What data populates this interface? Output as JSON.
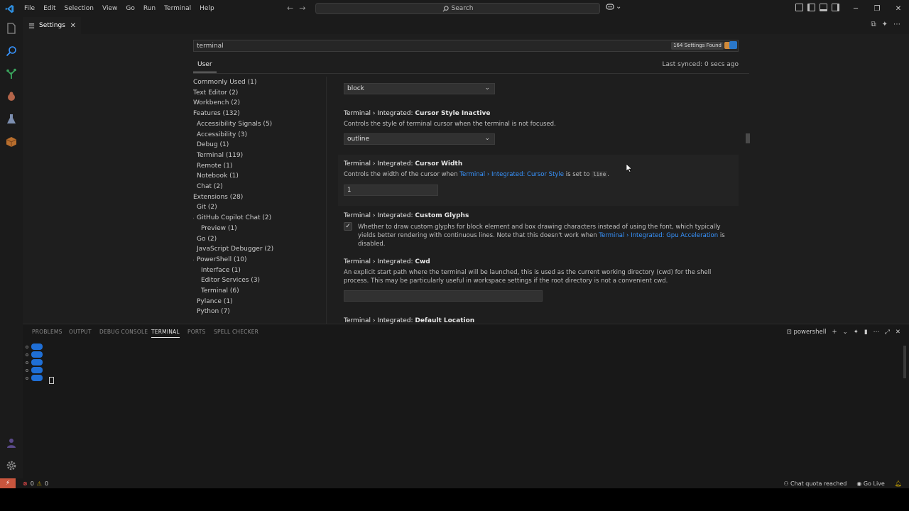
{
  "menu": [
    "File",
    "Edit",
    "Selection",
    "View",
    "Go",
    "Run",
    "Terminal",
    "Help"
  ],
  "search": {
    "placeholder": "Search"
  },
  "tab": {
    "title": "Settings"
  },
  "settings": {
    "query": "terminal",
    "found": "164 Settings Found",
    "scope": "User",
    "synced": "Last synced: 0 secs ago",
    "toc": [
      {
        "label": "Commonly Used (1)",
        "level": 0,
        "chev": ""
      },
      {
        "label": "Text Editor (2)",
        "level": 0,
        "chev": ""
      },
      {
        "label": "Workbench (2)",
        "level": 0,
        "chev": ""
      },
      {
        "label": "Features (132)",
        "level": 0,
        "chev": "v"
      },
      {
        "label": "Accessibility Signals (5)",
        "level": 1,
        "chev": ""
      },
      {
        "label": "Accessibility (3)",
        "level": 1,
        "chev": ""
      },
      {
        "label": "Debug (1)",
        "level": 1,
        "chev": ""
      },
      {
        "label": "Terminal (119)",
        "level": 1,
        "chev": ""
      },
      {
        "label": "Remote (1)",
        "level": 1,
        "chev": ""
      },
      {
        "label": "Notebook (1)",
        "level": 1,
        "chev": ""
      },
      {
        "label": "Chat (2)",
        "level": 1,
        "chev": ""
      },
      {
        "label": "Extensions (28)",
        "level": 0,
        "chev": "v"
      },
      {
        "label": "Git (2)",
        "level": 1,
        "chev": ""
      },
      {
        "label": "GitHub Copilot Chat (2)",
        "level": 1,
        "chev": "v"
      },
      {
        "label": "Preview (1)",
        "level": 2,
        "chev": ""
      },
      {
        "label": "Go (2)",
        "level": 1,
        "chev": ""
      },
      {
        "label": "JavaScript Debugger (2)",
        "level": 1,
        "chev": ""
      },
      {
        "label": "PowerShell (10)",
        "level": 1,
        "chev": "v"
      },
      {
        "label": "Interface (1)",
        "level": 2,
        "chev": ""
      },
      {
        "label": "Editor Services (3)",
        "level": 2,
        "chev": ""
      },
      {
        "label": "Terminal (6)",
        "level": 2,
        "chev": ""
      },
      {
        "label": "Pylance (1)",
        "level": 1,
        "chev": ""
      },
      {
        "label": "Python (7)",
        "level": 1,
        "chev": ""
      }
    ],
    "items": {
      "cursor_style": {
        "value": "block"
      },
      "cursor_style_inactive": {
        "prefix": "Terminal › Integrated: ",
        "name": "Cursor Style Inactive",
        "desc": "Controls the style of terminal cursor when the terminal is not focused.",
        "value": "outline"
      },
      "cursor_width": {
        "prefix": "Terminal › Integrated: ",
        "name": "Cursor Width",
        "desc_pre": "Controls the width of the cursor when ",
        "desc_link": "Terminal › Integrated: Cursor Style",
        "desc_mid": " is set to ",
        "desc_code": "line",
        "desc_post": ".",
        "value": "1"
      },
      "custom_glyphs": {
        "prefix": "Terminal › Integrated: ",
        "name": "Custom Glyphs",
        "desc_pre": "Whether to draw custom glyphs for block element and box drawing characters instead of using the font, which typically yields better rendering with continuous lines. Note that this doesn't work when ",
        "desc_link": "Terminal › Integrated: Gpu Acceleration",
        "desc_post": " is disabled.",
        "checked": "✓"
      },
      "cwd": {
        "prefix": "Terminal › Integrated: ",
        "name": "Cwd",
        "desc": "An explicit start path where the terminal will be launched, this is used as the current working directory (cwd) for the shell process. This may be particularly useful in workspace settings if the root directory is not a convenient cwd."
      },
      "default_location": {
        "prefix": "Terminal › Integrated: ",
        "name": "Default Location"
      }
    }
  },
  "panel": {
    "tabs": [
      "PROBLEMS",
      "OUTPUT",
      "DEBUG CONSOLE",
      "TERMINAL",
      "PORTS",
      "SPELL CHECKER"
    ],
    "shell": "powershell"
  },
  "status": {
    "errors": "0",
    "warnings": "0",
    "chat": "Chat quota reached",
    "golive": "Go Live"
  },
  "colors": {
    "accent": "#3794ff",
    "remote": "#c8553d",
    "terminal_prompt": "#1f6fd6"
  }
}
